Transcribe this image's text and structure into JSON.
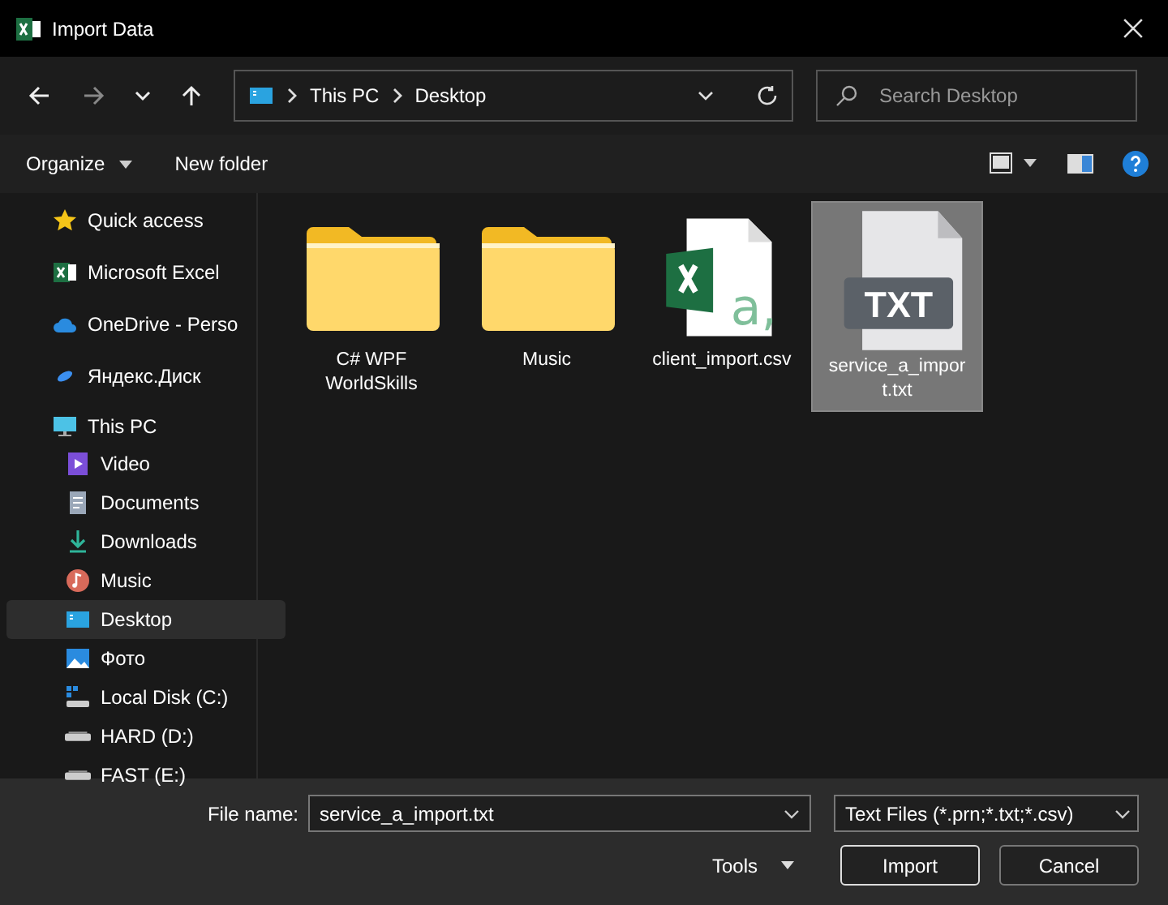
{
  "window": {
    "title": "Import Data"
  },
  "address": {
    "path": [
      "This PC",
      "Desktop"
    ]
  },
  "search": {
    "placeholder": "Search Desktop"
  },
  "toolbar": {
    "organize": "Organize",
    "new_folder": "New folder"
  },
  "sidebar": {
    "items": [
      {
        "label": "Quick access",
        "kind": "star",
        "selected": false
      },
      {
        "label": "Microsoft Excel",
        "kind": "excel",
        "selected": false
      },
      {
        "label": "OneDrive - Perso",
        "kind": "cloud",
        "selected": false
      },
      {
        "label": "Яндекс.Диск",
        "kind": "yadisk",
        "selected": false
      },
      {
        "label": "This PC",
        "kind": "pc",
        "selected": false,
        "children": [
          {
            "label": "Video",
            "kind": "video",
            "selected": false
          },
          {
            "label": "Documents",
            "kind": "docs",
            "selected": false
          },
          {
            "label": "Downloads",
            "kind": "download",
            "selected": false
          },
          {
            "label": "Music",
            "kind": "music",
            "selected": false
          },
          {
            "label": "Desktop",
            "kind": "desktop",
            "selected": true
          },
          {
            "label": "Фото",
            "kind": "photo",
            "selected": false
          },
          {
            "label": "Local Disk (C:)",
            "kind": "sysdisk",
            "selected": false
          },
          {
            "label": "HARD (D:)",
            "kind": "disk",
            "selected": false
          },
          {
            "label": "FAST (E:)",
            "kind": "disk",
            "selected": false
          }
        ]
      }
    ]
  },
  "files": [
    {
      "name": "C# WPF WorldSkills",
      "kind": "folder",
      "selected": false
    },
    {
      "name": "Music",
      "kind": "folder",
      "selected": false
    },
    {
      "name": "client_import.csv",
      "kind": "csv",
      "selected": false,
      "icon_label": "a,"
    },
    {
      "name": "service_a_import.txt",
      "kind": "txt",
      "selected": true,
      "icon_label": "TXT"
    }
  ],
  "footer": {
    "file_name_label": "File name:",
    "file_name": "service_a_import.txt",
    "file_type": "Text Files (*.prn;*.txt;*.csv)",
    "tools": "Tools",
    "import": "Import",
    "cancel": "Cancel"
  }
}
